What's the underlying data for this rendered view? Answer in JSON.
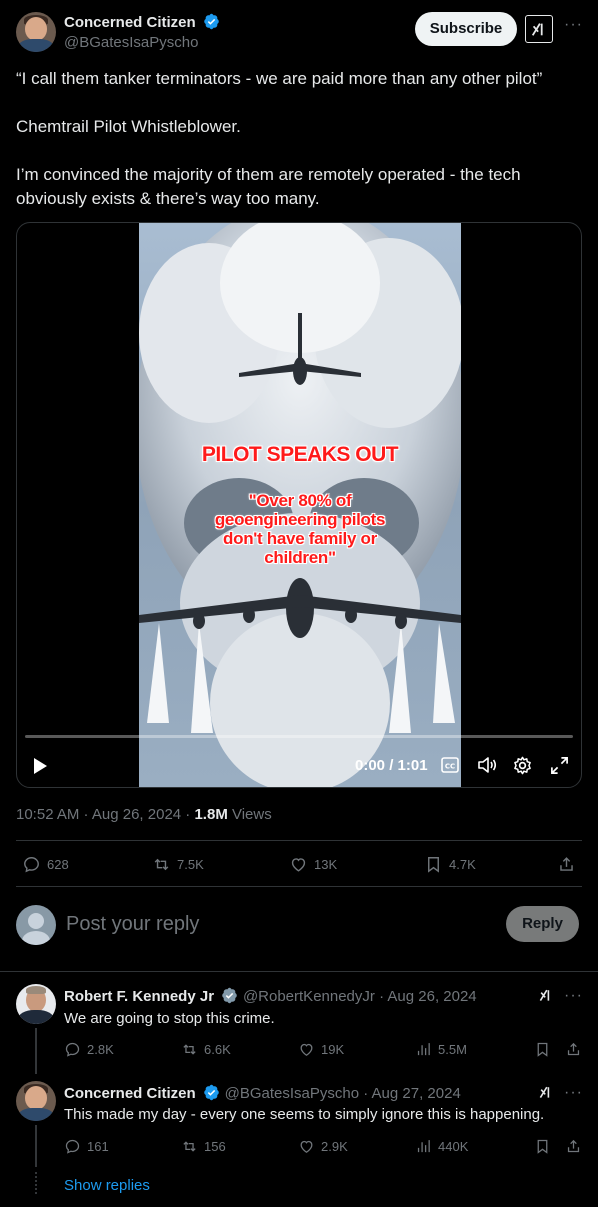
{
  "post": {
    "author_name": "Concerned Citizen",
    "author_handle": "@BGatesIsaPyscho",
    "subscribe_label": "Subscribe",
    "text_line1": "“I call them tanker terminators - we are paid more than any other pilot”",
    "text_line2": "Chemtrail Pilot Whistleblower.",
    "text_line3": "I’m convinced the majority of them are remotely operated - the tech obviously exists & there’s way too many.",
    "timestamp": "10:52 AM · Aug 26, 2024 · ",
    "views_count": "1.8M",
    "views_label": " Views"
  },
  "video": {
    "overlay_title": "PILOT SPEAKS OUT",
    "overlay_quote": "\"Over 80% of geoengineering pilots don't have family or children\"",
    "time": "0:00 / 1:01",
    "progress": 0
  },
  "actions": {
    "replies": "628",
    "reposts": "7.5K",
    "likes": "13K",
    "bookmarks": "4.7K"
  },
  "compose": {
    "placeholder": "Post your reply",
    "reply_label": "Reply"
  },
  "replies": [
    {
      "name": "Robert F. Kennedy Jr",
      "meta": "@RobertKennedyJr · Aug 26, 2024",
      "text": "We are going to stop this crime.",
      "replies": "2.8K",
      "reposts": "6.6K",
      "likes": "19K",
      "views": "5.5M"
    },
    {
      "name": "Concerned Citizen",
      "meta": "@BGatesIsaPyscho · Aug 27, 2024",
      "text": "This made my day - every one seems to simply ignore this is happening.",
      "replies": "161",
      "reposts": "156",
      "likes": "2.9K",
      "views": "440K"
    }
  ],
  "show_replies": "Show replies",
  "colors": {
    "accent": "#1d9bf0",
    "verified": "#1d9bf0",
    "muted": "#71767b",
    "divider": "#2f3336"
  }
}
